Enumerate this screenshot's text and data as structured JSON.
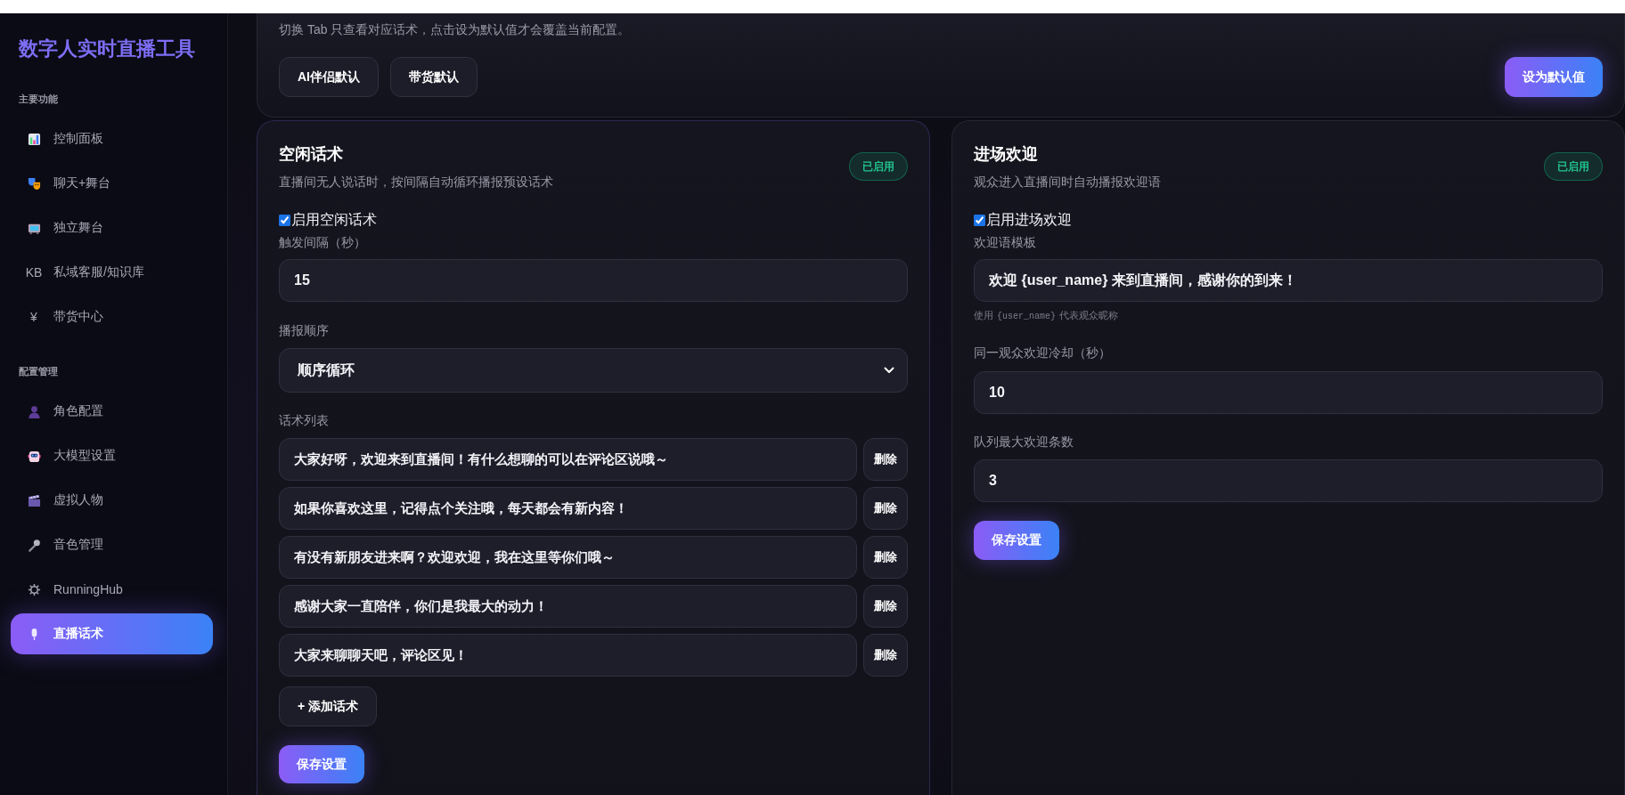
{
  "sidebar": {
    "title": "数字人实时直播工具",
    "sections": [
      {
        "heading": "主要功能",
        "items": [
          {
            "label": "控制面板",
            "selected": false
          },
          {
            "label": "聊天+舞台",
            "selected": false
          },
          {
            "label": "独立舞台",
            "selected": false
          },
          {
            "glyph": "KB",
            "label": "私域客服/知识库",
            "selected": false
          },
          {
            "glyph": "¥",
            "label": "带货中心",
            "selected": false
          }
        ]
      },
      {
        "heading": "配置管理",
        "items": [
          {
            "label": "角色配置",
            "selected": false
          },
          {
            "label": "大模型设置",
            "selected": false
          },
          {
            "label": "虚拟人物",
            "selected": false
          },
          {
            "label": "音色管理",
            "selected": false
          },
          {
            "label": "RunningHub",
            "selected": false
          },
          {
            "label": "直播话术",
            "selected": true
          }
        ]
      }
    ]
  },
  "defaults_card": {
    "note": "切换 Tab 只查看对应话术，点击设为默认值才会覆盖当前配置。",
    "preset_buttons": [
      "AI伴侣默认",
      "带货默认"
    ],
    "apply_button": "设为默认值"
  },
  "idle_card": {
    "title": "空闲话术",
    "subtitle": "直播间无人说话时，按间隔自动循环播报预设话术",
    "badge": "已启用",
    "enable": {
      "label": "启用空闲话术",
      "checked": true
    },
    "interval": {
      "label": "触发间隔（秒）",
      "value": "15"
    },
    "order": {
      "label": "播报顺序",
      "value": "顺序循环"
    },
    "scripts": {
      "label": "话术列表",
      "items": [
        {
          "text": "大家好呀，欢迎来到直播间！有什么想聊的可以在评论区说哦～",
          "delete_button": "删除"
        },
        {
          "text": "如果你喜欢这里，记得点个关注哦，每天都会有新内容！",
          "delete_button": "删除"
        },
        {
          "text": "有没有新朋友进来啊？欢迎欢迎，我在这里等你们哦～",
          "delete_button": "删除"
        },
        {
          "text": "感谢大家一直陪伴，你们是我最大的动力！",
          "delete_button": "删除"
        },
        {
          "text": "大家来聊聊天吧，评论区见！",
          "delete_button": "删除"
        }
      ]
    },
    "add_button": "+ 添加话术",
    "save_button": "保存设置"
  },
  "welcome_card": {
    "title": "进场欢迎",
    "subtitle": "观众进入直播间时自动播报欢迎语",
    "badge": "已启用",
    "enable": {
      "label": "启用进场欢迎",
      "checked": true
    },
    "template": {
      "label": "欢迎语模板",
      "value": "欢迎 {user_name} 来到直播间，感谢你的到来！",
      "hint": {
        "before": "使用",
        "code": "{user_name}",
        "after": "代表观众昵称"
      }
    },
    "cooldown": {
      "label": "同一观众欢迎冷却（秒）",
      "value": "10"
    },
    "queue": {
      "label": "队列最大欢迎条数",
      "value": "3"
    },
    "save_button": "保存设置"
  }
}
